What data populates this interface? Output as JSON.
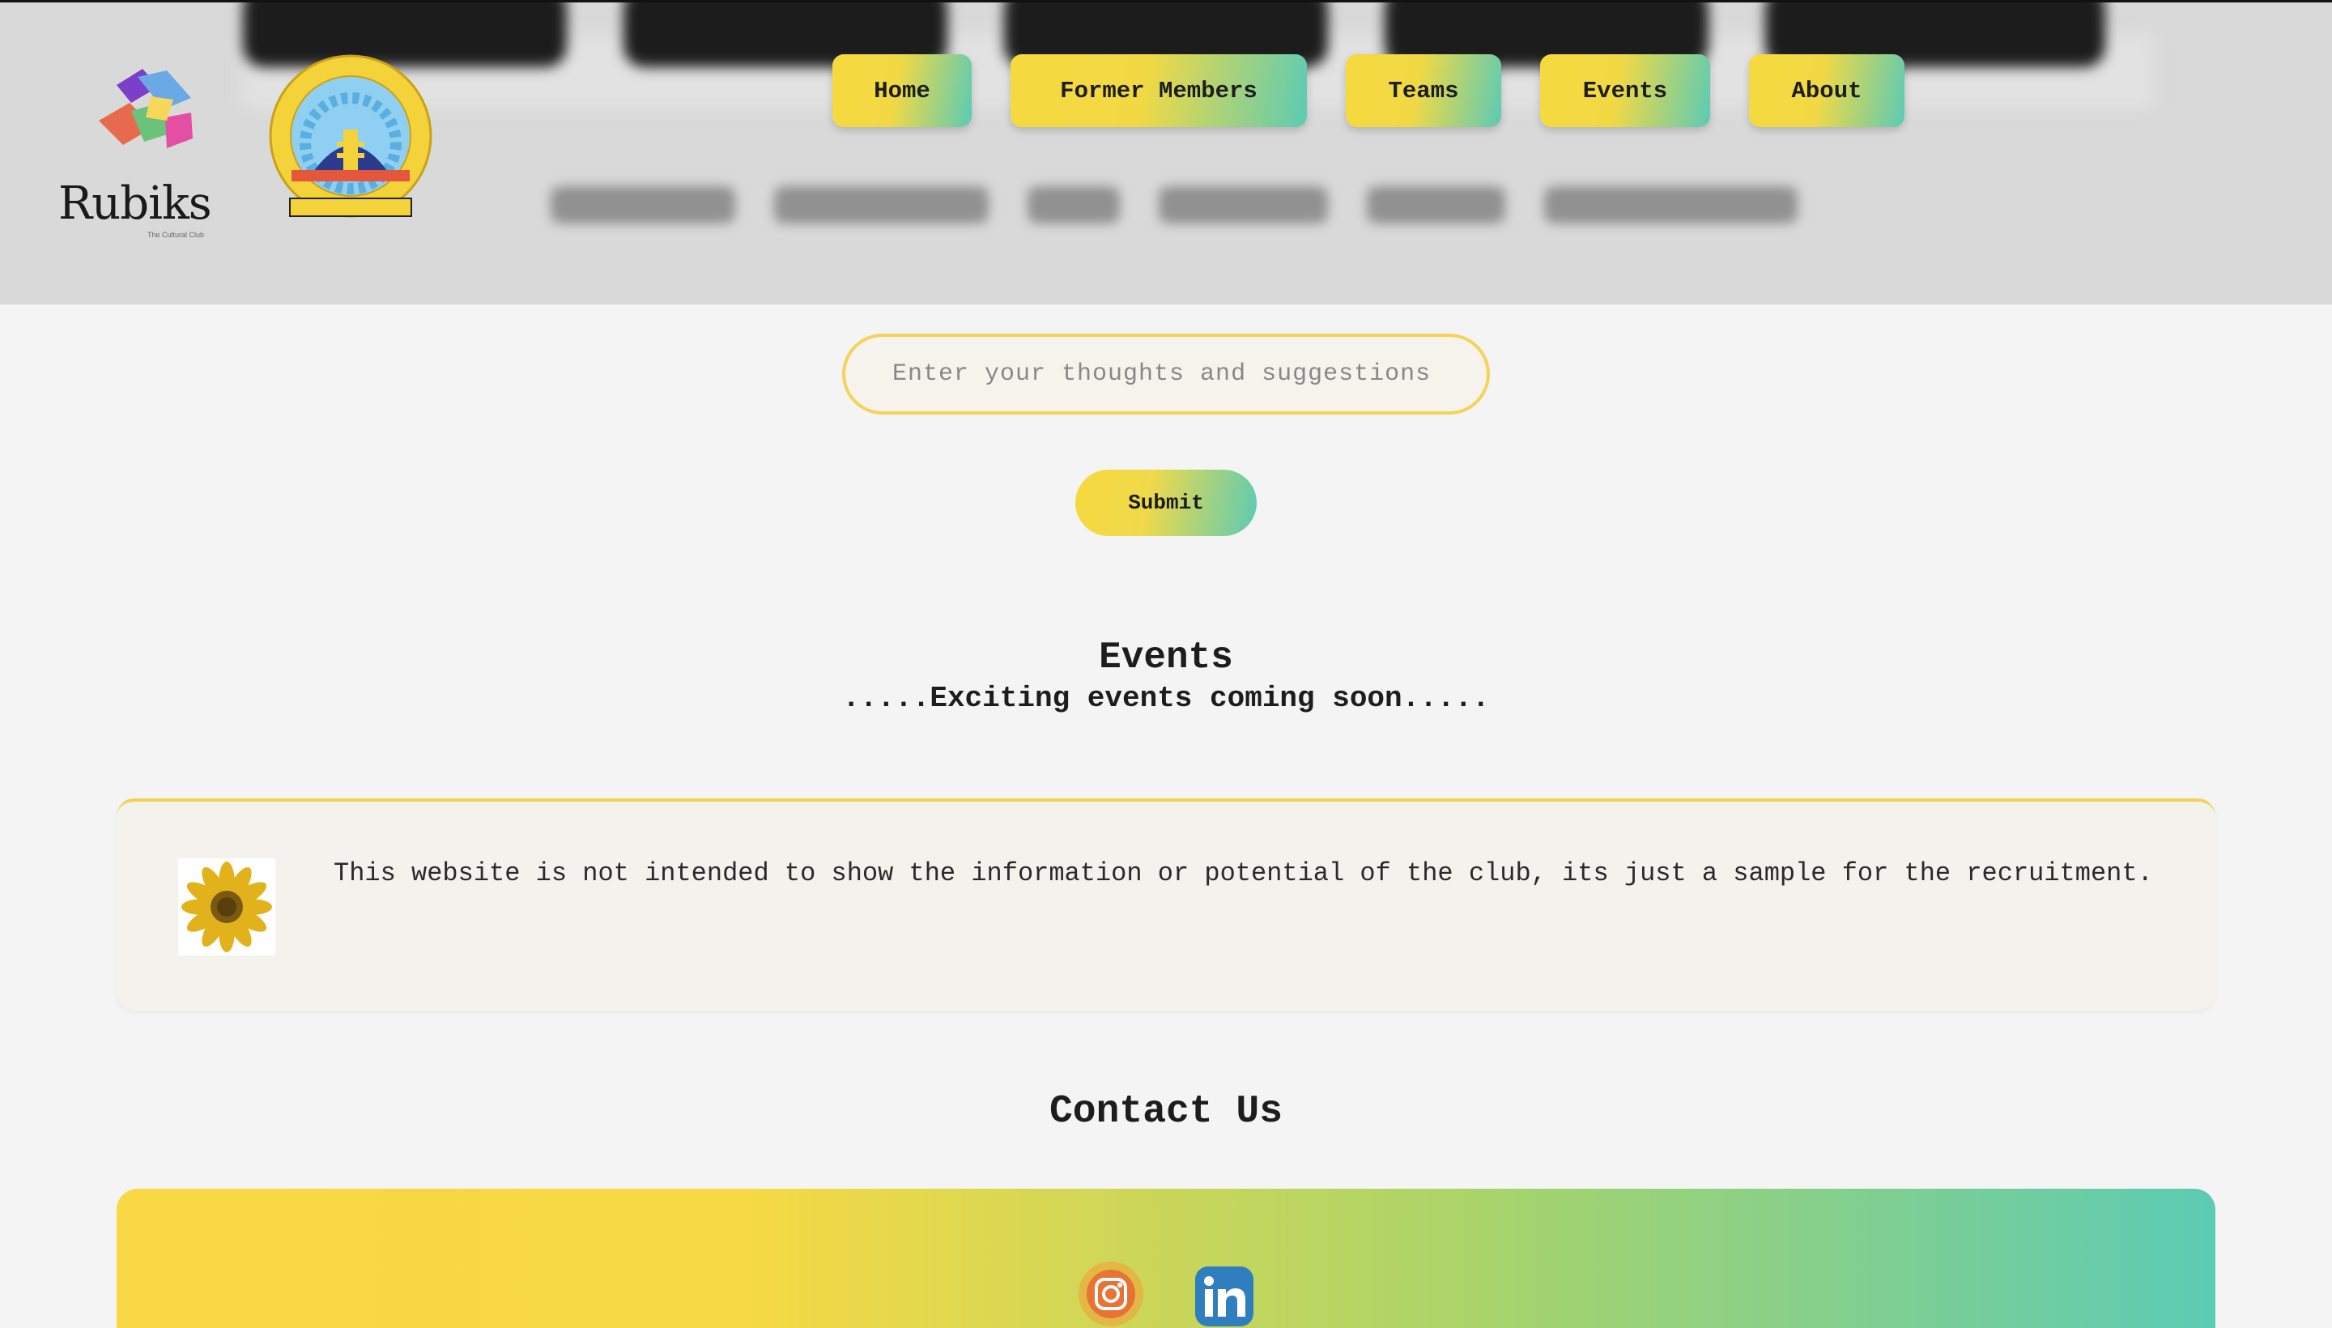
{
  "colors": {
    "accent_yellow": "#f6d93f",
    "accent_teal": "#5ccbb4",
    "header_bg": "#d9d9d9",
    "page_bg": "#f4f4f4"
  },
  "logos": {
    "rubiks_wordmark": "Rubiks",
    "rubiks_tagline": "The Cultural Club",
    "nit_seal_text": "Maulana Azad National Institute of Technology"
  },
  "nav": {
    "items": [
      {
        "label": "Home"
      },
      {
        "label": "Former Members"
      },
      {
        "label": "Teams"
      },
      {
        "label": "Events"
      },
      {
        "label": "About"
      }
    ]
  },
  "feedback": {
    "placeholder": "Enter your thoughts and suggestions",
    "submit_label": "Submit"
  },
  "events": {
    "title": "Events",
    "subtitle": ".....Exciting events coming soon....."
  },
  "notice": {
    "icon": "sunflower-icon",
    "text": "This website is not intended to show the information or potential of the club, its just a sample for the recruitment."
  },
  "contact": {
    "title": "Contact Us",
    "socials": [
      {
        "icon": "instagram-icon"
      },
      {
        "icon": "linkedin-icon"
      }
    ]
  }
}
